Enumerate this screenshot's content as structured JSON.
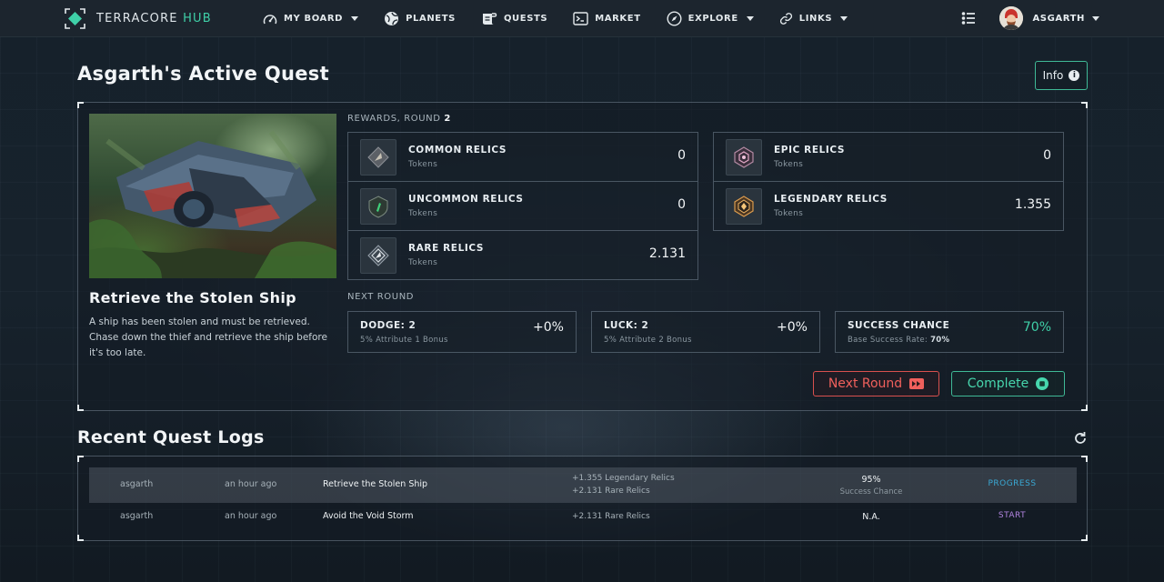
{
  "brand": {
    "name": "TERRACORE",
    "suffix": "HUB"
  },
  "nav": {
    "items": [
      {
        "label": "MY BOARD",
        "icon": "gauge-icon",
        "dropdown": true
      },
      {
        "label": "PLANETS",
        "icon": "planet-icon",
        "dropdown": false
      },
      {
        "label": "QUESTS",
        "icon": "scroll-icon",
        "dropdown": false
      },
      {
        "label": "MARKET",
        "icon": "terminal-icon",
        "dropdown": false
      },
      {
        "label": "EXPLORE",
        "icon": "compass-icon",
        "dropdown": true
      },
      {
        "label": "LINKS",
        "icon": "link-icon",
        "dropdown": true
      }
    ],
    "user": {
      "name": "ASGARTH"
    }
  },
  "quest_panel": {
    "title": "Asgarth's Active Quest",
    "info_label": "Info",
    "quest_name": "Retrieve the Stolen Ship",
    "quest_description": "A ship has been stolen and must be retrieved. Chase down the thief and retrieve the ship before it's too late.",
    "rewards_label": "REWARDS, ROUND",
    "round": "2",
    "relics_left": [
      {
        "name": "COMMON RELICS",
        "sub": "Tokens",
        "value": "0"
      },
      {
        "name": "UNCOMMON RELICS",
        "sub": "Tokens",
        "value": "0"
      },
      {
        "name": "RARE RELICS",
        "sub": "Tokens",
        "value": "2.131"
      }
    ],
    "relics_right": [
      {
        "name": "EPIC RELICS",
        "sub": "Tokens",
        "value": "0"
      },
      {
        "name": "LEGENDARY RELICS",
        "sub": "Tokens",
        "value": "1.355"
      }
    ],
    "next_round_label": "NEXT ROUND",
    "stats": [
      {
        "title": "DODGE: 2",
        "sub": "5% Attribute 1 Bonus",
        "value": "+0%"
      },
      {
        "title": "LUCK: 2",
        "sub": "5% Attribute 2 Bonus",
        "value": "+0%"
      },
      {
        "title": "SUCCESS CHANCE",
        "sub_label": "Base Success Rate:",
        "sub_value": "70%",
        "value": "70%"
      }
    ],
    "next_round_button": "Next Round",
    "complete_button": "Complete"
  },
  "logs": {
    "title": "Recent Quest Logs",
    "rows": [
      {
        "user": "asgarth",
        "time": "an hour ago",
        "quest": "Retrieve the Stolen Ship",
        "rewards": [
          "+1.355 Legendary Relics",
          "+2.131 Rare Relics"
        ],
        "chance": "95%",
        "chance_label": "Success Chance",
        "status": "PROGRESS"
      },
      {
        "user": "asgarth",
        "time": "an hour ago",
        "quest": "Avoid the Void Storm",
        "rewards": [
          "+2.131 Rare Relics"
        ],
        "chance": "N.A.",
        "chance_label": "",
        "status": "START"
      }
    ]
  },
  "colors": {
    "accent": "#3fd0a8",
    "danger": "#f0605c",
    "progress": "#3aa9d4",
    "start": "#b184e0"
  }
}
